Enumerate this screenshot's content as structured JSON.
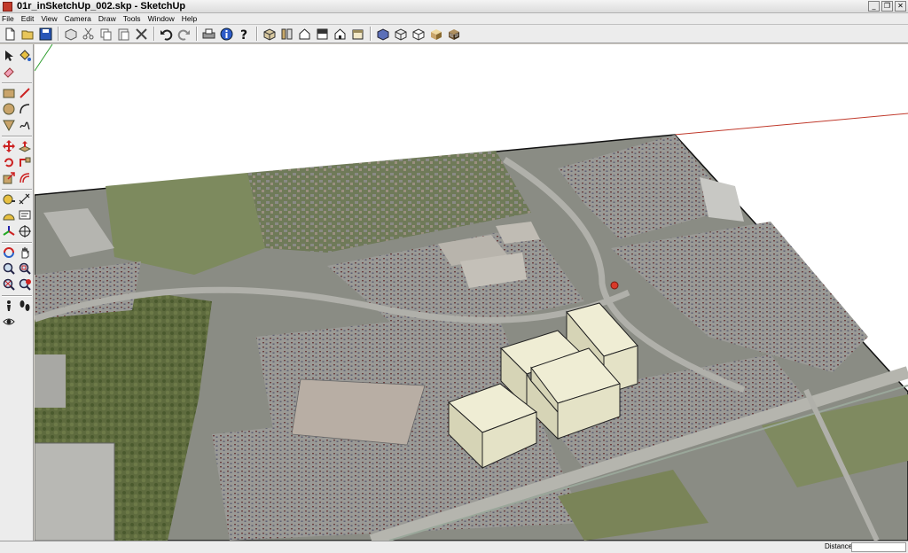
{
  "window": {
    "title": "01r_inSketchUp_002.skp - SketchUp",
    "controls": [
      "minimize-icon",
      "restore-icon",
      "close-icon"
    ]
  },
  "menu": [
    "File",
    "Edit",
    "View",
    "Camera",
    "Draw",
    "Tools",
    "Window",
    "Help"
  ],
  "toolbar_icons": [
    "new-icon",
    "open-icon",
    "save-icon",
    "make-component-icon",
    "cut-icon",
    "copy-icon",
    "paste-icon",
    "erase-icon",
    "undo-icon",
    "redo-icon",
    "print-icon",
    "model-info-icon",
    "help-icon",
    "iso-view-icon",
    "top-view-icon",
    "front-view-icon",
    "right-view-icon",
    "back-view-icon",
    "left-view-icon",
    "xray-icon",
    "wireframe-icon",
    "hidden-line-icon",
    "shaded-icon",
    "shaded-textures-icon"
  ],
  "left_tools": [
    "select-icon",
    "paint-bucket-icon",
    "eraser-icon",
    "rectangle-icon",
    "line-icon",
    "circle-icon",
    "arc-icon",
    "polygon-icon",
    "freehand-icon",
    "move-icon",
    "push-pull-icon",
    "rotate-icon",
    "follow-me-icon",
    "scale-icon",
    "offset-icon",
    "tape-measure-icon",
    "dimension-icon",
    "protractor-icon",
    "text-icon",
    "axes-icon",
    "3d-text-icon",
    "orbit-icon",
    "pan-icon",
    "zoom-icon",
    "zoom-window-icon",
    "zoom-extents-icon",
    "previous-view-icon",
    "position-camera-icon",
    "walk-icon",
    "look-around-icon"
  ],
  "status": {
    "label": "Distance",
    "value": ""
  },
  "colors": {
    "axis_red": "#c0392b",
    "axis_green": "#2e9e2e",
    "building": "#e4e2c6",
    "asphalt": "#8c8c88"
  }
}
